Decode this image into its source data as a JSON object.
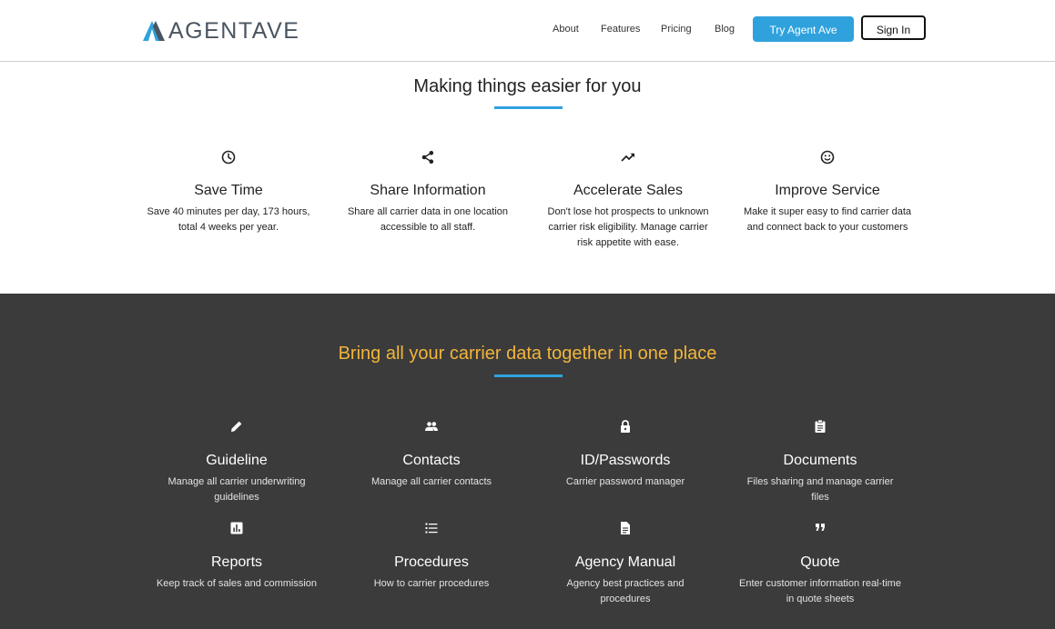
{
  "brand": {
    "name": "AGENTAVE"
  },
  "nav": {
    "links": [
      "About",
      "Features",
      "Pricing",
      "Blog"
    ],
    "try_label": "Try Agent Ave",
    "signin_label": "Sign In"
  },
  "colors": {
    "accent": "#2fa2dd",
    "dark_bg": "#3b3b3b",
    "highlight": "#f2b53a"
  },
  "benefits": {
    "title": "Making things easier for you",
    "items": [
      {
        "icon": "clock-icon",
        "title": "Save Time",
        "desc_lines": [
          "Save 40 minutes per day, 173 hours,",
          "total 4 weeks per year."
        ]
      },
      {
        "icon": "share-icon",
        "title": "Share Information",
        "desc_lines": [
          "Share all carrier data in one location",
          "accessible to all staff."
        ]
      },
      {
        "icon": "trending-up-icon",
        "title": "Accelerate Sales",
        "desc_lines": [
          "Don't lose hot prospects to unknown",
          "carrier risk eligibility. Manage carrier",
          "risk appetite with ease."
        ]
      },
      {
        "icon": "smiley-icon",
        "title": "Improve Service",
        "desc_lines": [
          "Make it super easy to find carrier data",
          "and connect back to your customers"
        ]
      }
    ]
  },
  "features": {
    "title": "Bring all your carrier data together in one place",
    "items": [
      {
        "icon": "pencil-icon",
        "title": "Guideline",
        "desc_lines": [
          "Manage all carrier underwriting",
          "guidelines"
        ]
      },
      {
        "icon": "people-icon",
        "title": "Contacts",
        "desc_lines": [
          "Manage all carrier contacts"
        ]
      },
      {
        "icon": "lock-icon",
        "title": "ID/Passwords",
        "desc_lines": [
          "Carrier password manager"
        ]
      },
      {
        "icon": "clipboard-icon",
        "title": "Documents",
        "desc_lines": [
          "Files sharing and manage carrier",
          "files"
        ]
      },
      {
        "icon": "bar-chart-icon",
        "title": "Reports",
        "desc_lines": [
          "Keep track of sales and commission"
        ]
      },
      {
        "icon": "numbered-list-icon",
        "title": "Procedures",
        "desc_lines": [
          "How to carrier procedures"
        ]
      },
      {
        "icon": "document-icon",
        "title": "Agency Manual",
        "desc_lines": [
          "Agency best practices and",
          "procedures"
        ]
      },
      {
        "icon": "quote-icon",
        "title": "Quote",
        "desc_lines": [
          "Enter customer information real-time",
          "in quote sheets"
        ]
      }
    ]
  }
}
